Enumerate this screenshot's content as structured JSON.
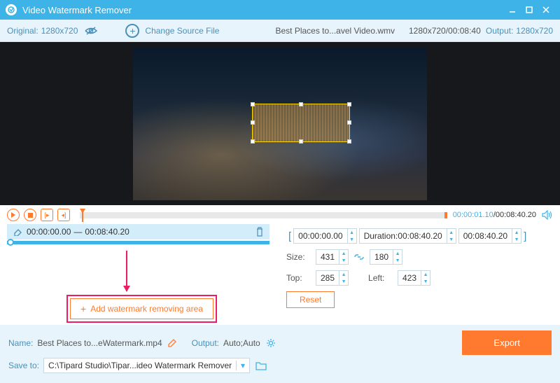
{
  "app": {
    "title": "Video Watermark Remover"
  },
  "toolbar": {
    "original_label": "Original:",
    "original_value": "1280x720",
    "change_source": "Change Source File",
    "filename": "Best Places to...avel Video.wmv",
    "dimensions": "1280x720/00:08:40",
    "output_label": "Output:",
    "output_value": "1280x720"
  },
  "playback": {
    "current_time": "00:00:01.10",
    "total_time": "00:08:40.20"
  },
  "segment": {
    "start": "00:00:00.00",
    "separator": "—",
    "end": "00:08:40.20"
  },
  "params": {
    "time_start": "00:00:00.00",
    "duration_label": "Duration:",
    "duration_value": "00:08:40.20",
    "time_end": "00:08:40.20",
    "size_label": "Size:",
    "size_w": "431",
    "size_h": "180",
    "top_label": "Top:",
    "top_val": "285",
    "left_label": "Left:",
    "left_val": "423",
    "reset": "Reset"
  },
  "add_area": "Add watermark removing area",
  "bottom": {
    "name_label": "Name:",
    "name_value": "Best Places to...eWatermark.mp4",
    "output_label": "Output:",
    "output_value": "Auto;Auto",
    "saveto_label": "Save to:",
    "saveto_value": "C:\\Tipard Studio\\Tipar...ideo Watermark Remover",
    "export": "Export"
  }
}
